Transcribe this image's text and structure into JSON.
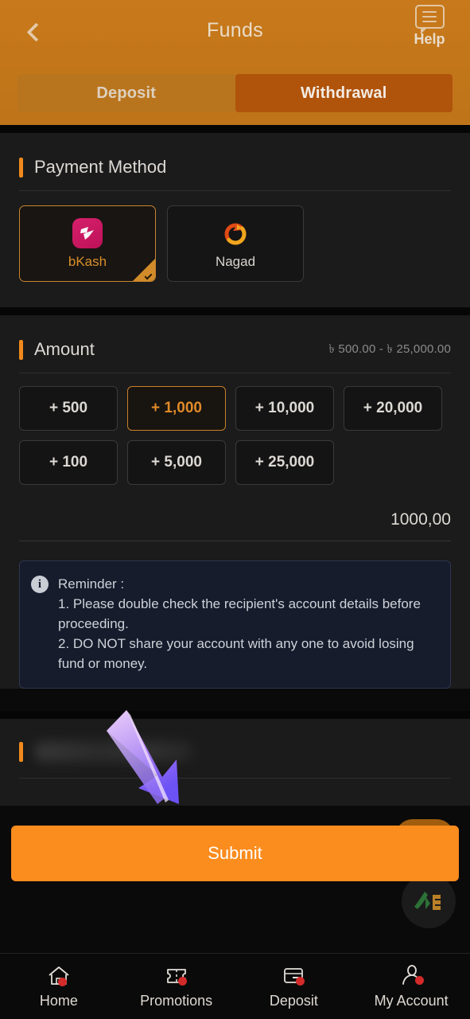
{
  "header": {
    "title": "Funds",
    "back_icon": "chevron-left-icon",
    "help_label": "Help",
    "help_icon": "chat-bubble-icon",
    "tabs": [
      {
        "label": "Deposit",
        "active": false
      },
      {
        "label": "Withdrawal",
        "active": true
      }
    ],
    "bg_color": "#c2761a",
    "active_tab_color": "#b0530b"
  },
  "payment_method": {
    "section_title": "Payment Method",
    "accent_color": "#f08a1c",
    "options": [
      {
        "name": "bKash",
        "icon": "bkash-logo",
        "selected": true,
        "brand_color": "#d6206b"
      },
      {
        "name": "Nagad",
        "icon": "nagad-logo",
        "selected": false,
        "brand_color": "#e8531f"
      }
    ]
  },
  "amount": {
    "section_title": "Amount",
    "range_note": "৳ 500.00 - ৳ 25,000.00",
    "min": 500,
    "max": 25000,
    "currency_symbol": "৳",
    "quick_chips": [
      {
        "label": "+ 500",
        "value": 500,
        "active": false
      },
      {
        "label": "+ 1,000",
        "value": 1000,
        "active": true
      },
      {
        "label": "+ 10,000",
        "value": 10000,
        "active": false
      },
      {
        "label": "+ 20,000",
        "value": 20000,
        "active": false
      },
      {
        "label": "+ 100",
        "value": 100,
        "active": false
      },
      {
        "label": "+ 5,000",
        "value": 5000,
        "active": false
      },
      {
        "label": "+ 25,000",
        "value": 25000,
        "active": false
      }
    ],
    "entered_value": "1000,00"
  },
  "reminder": {
    "icon": "info-icon",
    "title": "Reminder :",
    "line1": "1. Please double check the recipient's account details before proceeding.",
    "line2": "2. DO NOT share your account with any one to avoid losing fund or money."
  },
  "blurred_section": {
    "title": "",
    "redacted": true
  },
  "overlay": {
    "arrow_icon": "arrow-down-right-pointer",
    "arrow_color_top": "#d9a0f0",
    "arrow_color_bottom": "#6c52f5"
  },
  "submit": {
    "label": "Submit",
    "color": "#fb8c1e"
  },
  "bottom_nav": [
    {
      "label": "Home",
      "icon": "home-icon"
    },
    {
      "label": "Promotions",
      "icon": "ticket-icon"
    },
    {
      "label": "Deposit",
      "icon": "wallet-icon"
    },
    {
      "label": "My Account",
      "icon": "user-icon"
    }
  ]
}
